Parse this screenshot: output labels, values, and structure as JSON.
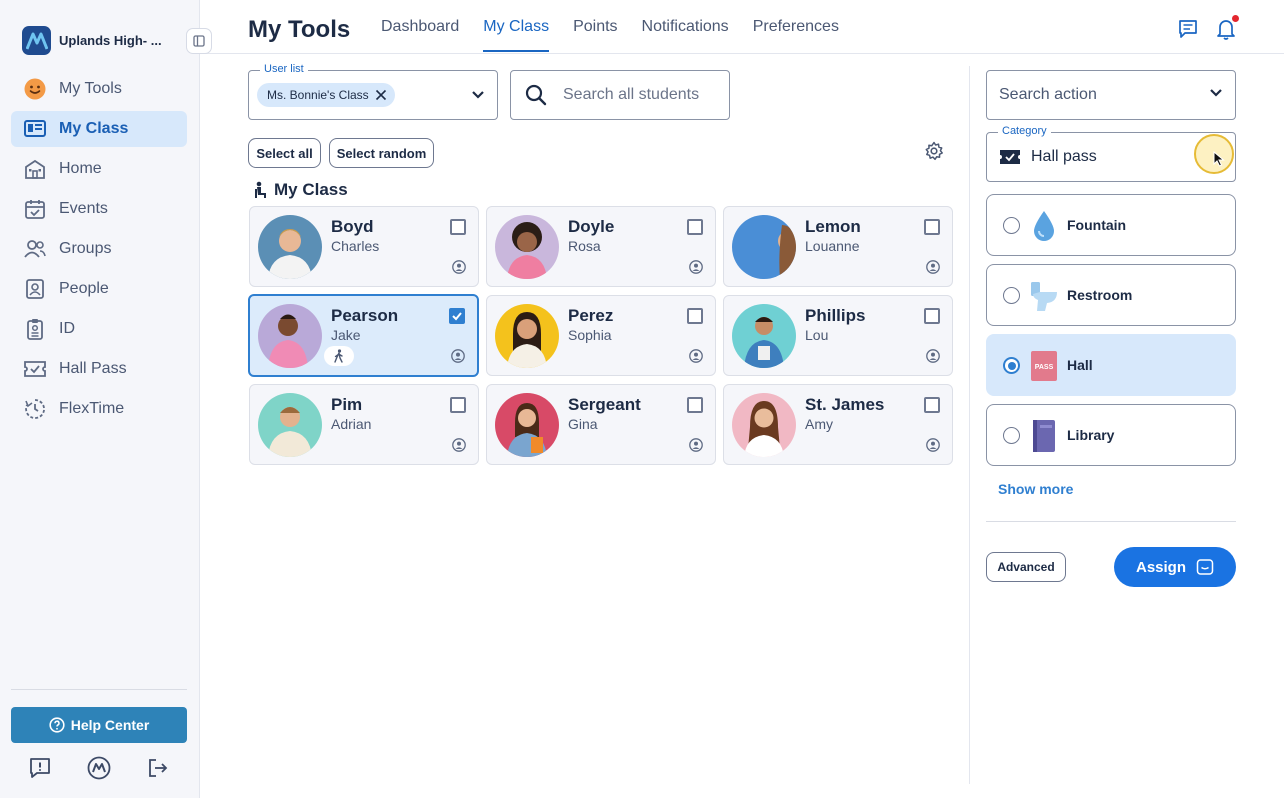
{
  "sidebar": {
    "brand_name": "Uplands High- ...",
    "items": [
      {
        "label": "My Tools",
        "icon": "smiley-icon"
      },
      {
        "label": "My Class",
        "icon": "class-board-icon"
      },
      {
        "label": "Home",
        "icon": "school-building-icon"
      },
      {
        "label": "Events",
        "icon": "calendar-check-icon"
      },
      {
        "label": "Groups",
        "icon": "groups-icon"
      },
      {
        "label": "People",
        "icon": "person-portrait-icon"
      },
      {
        "label": "ID",
        "icon": "id-badge-icon"
      },
      {
        "label": "Hall Pass",
        "icon": "hall-pass-ticket-icon"
      },
      {
        "label": "FlexTime",
        "icon": "flextime-clock-icon"
      }
    ],
    "active_item": "My Class",
    "help_label": "Help Center"
  },
  "header": {
    "title": "My Tools",
    "tabs": [
      "Dashboard",
      "My Class",
      "Points",
      "Notifications",
      "Preferences"
    ],
    "active_tab": "My Class"
  },
  "filters": {
    "user_list_label": "User list",
    "user_list_chip": "Ms. Bonnie's Class",
    "search_placeholder": "Search all students",
    "select_all_label": "Select all",
    "select_random_label": "Select random"
  },
  "class_section": {
    "title": "My Class",
    "students": [
      {
        "last": "Boyd",
        "first": "Charles",
        "selected": false,
        "bg": "#5b8fb5"
      },
      {
        "last": "Doyle",
        "first": "Rosa",
        "selected": false,
        "bg": "#c9b7dc"
      },
      {
        "last": "Lemon",
        "first": "Louanne",
        "selected": false,
        "bg": "#4a8ed6"
      },
      {
        "last": "Pearson",
        "first": "Jake",
        "selected": true,
        "bg": "#b9a9d8"
      },
      {
        "last": "Perez",
        "first": "Sophia",
        "selected": false,
        "bg": "#f4c21c"
      },
      {
        "last": "Phillips",
        "first": "Lou",
        "selected": false,
        "bg": "#6fd0d3"
      },
      {
        "last": "Pim",
        "first": "Adrian",
        "selected": false,
        "bg": "#7fd4c8"
      },
      {
        "last": "Sergeant",
        "first": "Gina",
        "selected": false,
        "bg": "#d84a67"
      },
      {
        "last": "St. James",
        "first": "Amy",
        "selected": false,
        "bg": "#f1b8c4"
      }
    ]
  },
  "actions": {
    "search_action_placeholder": "Search action",
    "category_label": "Category",
    "category_value": "Hall pass",
    "options": [
      {
        "label": "Fountain",
        "icon": "water-drop-icon",
        "checked": false
      },
      {
        "label": "Restroom",
        "icon": "toilet-icon",
        "checked": false
      },
      {
        "label": "Hall",
        "icon": "hall-pass-card-icon",
        "checked": true,
        "badge_text": "PASS"
      },
      {
        "label": "Library",
        "icon": "book-icon",
        "checked": false
      }
    ],
    "show_more_label": "Show more",
    "advanced_label": "Advanced",
    "assign_label": "Assign"
  },
  "colors": {
    "accent": "#1a73e2",
    "active_bg": "#d7e8fb",
    "sidebar_bg": "#f5f6fa",
    "help_button": "#2e83b8"
  }
}
